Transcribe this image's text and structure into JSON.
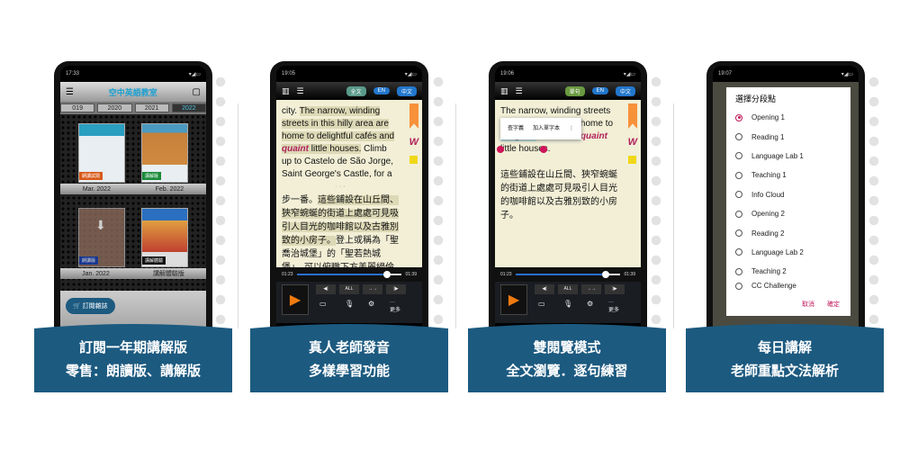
{
  "panels": [
    {
      "status_time": "17:33",
      "caption": [
        "訂閱一年期講解版",
        "零售：朗讀版、講解版"
      ],
      "logo": "空中英語教室",
      "years": [
        "019",
        "2020",
        "2021",
        "2022"
      ],
      "active_year": "2022",
      "covers": [
        {
          "tag": "朗讀試閱",
          "tag_color": "#d85a1a",
          "label": "Mar. 2022"
        },
        {
          "tag": "講解版",
          "tag_color": "#1a8a3a",
          "label": "Feb. 2022"
        },
        {
          "tag": "朗讀版",
          "tag_color": "#1a40b0",
          "label": "Jan. 2022"
        },
        {
          "tag": "講解體驗",
          "tag_color": "#111111",
          "label": "講解體驗版"
        }
      ],
      "subscribe": "訂閱雜誌"
    },
    {
      "status_time": "19:05",
      "caption": [
        "真人老師發音",
        "多樣學習功能"
      ],
      "modes": [
        "全文",
        "EN",
        "中文"
      ],
      "en_pre": "city. ",
      "en_hl1": "The narrow, winding streets in this hilly area are home to delightful cafés and ",
      "quaint": "quaint",
      "en_hl2": " little houses.",
      "en_post": " Climb up to Castelo de São Jorge, Saint George's Castle, for a",
      "zh_pre": "步一番。",
      "zh_hl": "這些鋪設在山丘間、狹窄蜿蜒的街道上處處可見吸引人目光的咖啡館以及古雅別致的小房子。",
      "zh_post": "登上或稱為「聖喬治城堡」的「聖若熱城堡」，可以俯瞰下方美麗絕倫",
      "time_current": "01:23",
      "time_total": "01:39",
      "progress": 0.86,
      "all": "ALL",
      "more": "更多"
    },
    {
      "status_time": "19:06",
      "caption": [
        "雙閱覽模式",
        "全文瀏覽．逐句練習"
      ],
      "modes": [
        "單句",
        "EN",
        "中文"
      ],
      "en_a": "The narrow, winding streets in this hilly area are home to ",
      "selected": "delightful",
      "en_b": " cafés and ",
      "quaint": "quaint",
      "en_c": " little houses.",
      "zh": "這些鋪設在山丘間、狹窄蜿蜒的街道上處處可見吸引人目光的咖啡館以及古雅別致的小房子。",
      "popup": [
        "查字義",
        "加入單字本"
      ],
      "time_current": "01:23",
      "time_total": "01:39",
      "progress": 0.86,
      "all": "ALL",
      "more": "更多"
    },
    {
      "status_time": "19:07",
      "caption": [
        "每日講解",
        "老師重點文法解析"
      ],
      "dialog_title": "選擇分段點",
      "options": [
        "Opening 1",
        "Reading 1",
        "Language Lab 1",
        "Teaching 1",
        "Info Cloud",
        "Opening 2",
        "Reading 2",
        "Language Lab 2",
        "Teaching 2",
        "CC Challenge"
      ],
      "selected_option": "Opening 1",
      "cancel": "取消",
      "ok": "確定"
    }
  ],
  "colors": {
    "banner": "#1c5a80",
    "accent": "#c0185a",
    "reader_bg": "#f2efd6"
  }
}
